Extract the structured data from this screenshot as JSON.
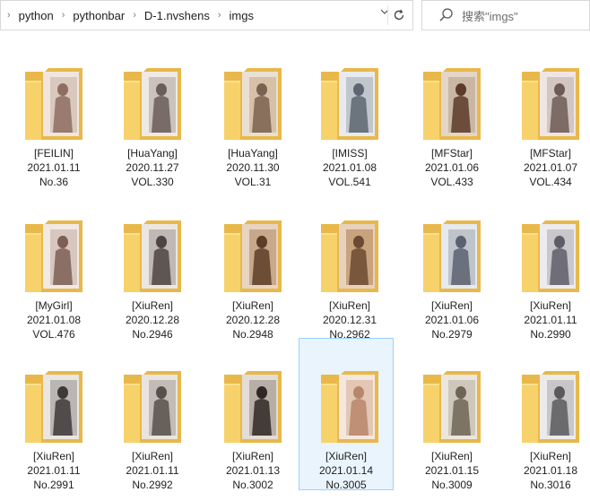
{
  "address": {
    "crumbs": [
      "python",
      "pythonbar",
      "D-1.nvshens",
      "imgs"
    ]
  },
  "search": {
    "placeholder": "搜索\"imgs\""
  },
  "folders": [
    {
      "label1": "[FEILIN]",
      "label2": "2021.01.11",
      "label3": "No.36"
    },
    {
      "label1": "[HuaYang]",
      "label2": "2020.11.27",
      "label3": "VOL.330"
    },
    {
      "label1": "[HuaYang]",
      "label2": "2020.11.30",
      "label3": "VOL.31"
    },
    {
      "label1": "[IMISS]",
      "label2": "2021.01.08",
      "label3": "VOL.541"
    },
    {
      "label1": "[MFStar]",
      "label2": "2021.01.06",
      "label3": "VOL.433"
    },
    {
      "label1": "[MFStar]",
      "label2": "2021.01.07",
      "label3": "VOL.434"
    },
    {
      "label1": "[MyGirl]",
      "label2": "2021.01.08",
      "label3": "VOL.476"
    },
    {
      "label1": "[XiuRen]",
      "label2": "2020.12.28",
      "label3": "No.2946"
    },
    {
      "label1": "[XiuRen]",
      "label2": "2020.12.28",
      "label3": "No.2948"
    },
    {
      "label1": "[XiuRen]",
      "label2": "2020.12.31",
      "label3": "No.2962"
    },
    {
      "label1": "[XiuRen]",
      "label2": "2021.01.06",
      "label3": "No.2979"
    },
    {
      "label1": "[XiuRen]",
      "label2": "2021.01.11",
      "label3": "No.2990"
    },
    {
      "label1": "[XiuRen]",
      "label2": "2021.01.11",
      "label3": "No.2991"
    },
    {
      "label1": "[XiuRen]",
      "label2": "2021.01.11",
      "label3": "No.2992"
    },
    {
      "label1": "[XiuRen]",
      "label2": "2021.01.13",
      "label3": "No.3002"
    },
    {
      "label1": "[XiuRen]",
      "label2": "2021.01.14",
      "label3": "No.3005"
    },
    {
      "label1": "[XiuRen]",
      "label2": "2021.01.15",
      "label3": "No.3009"
    },
    {
      "label1": "[XiuRen]",
      "label2": "2021.01.18",
      "label3": "No.3016"
    }
  ],
  "colors": {
    "folder_back": "#e8b84a",
    "folder_front": "#f7d26a",
    "selection_border": "#99d1ff",
    "selection_fill": "#eaf4fd"
  }
}
